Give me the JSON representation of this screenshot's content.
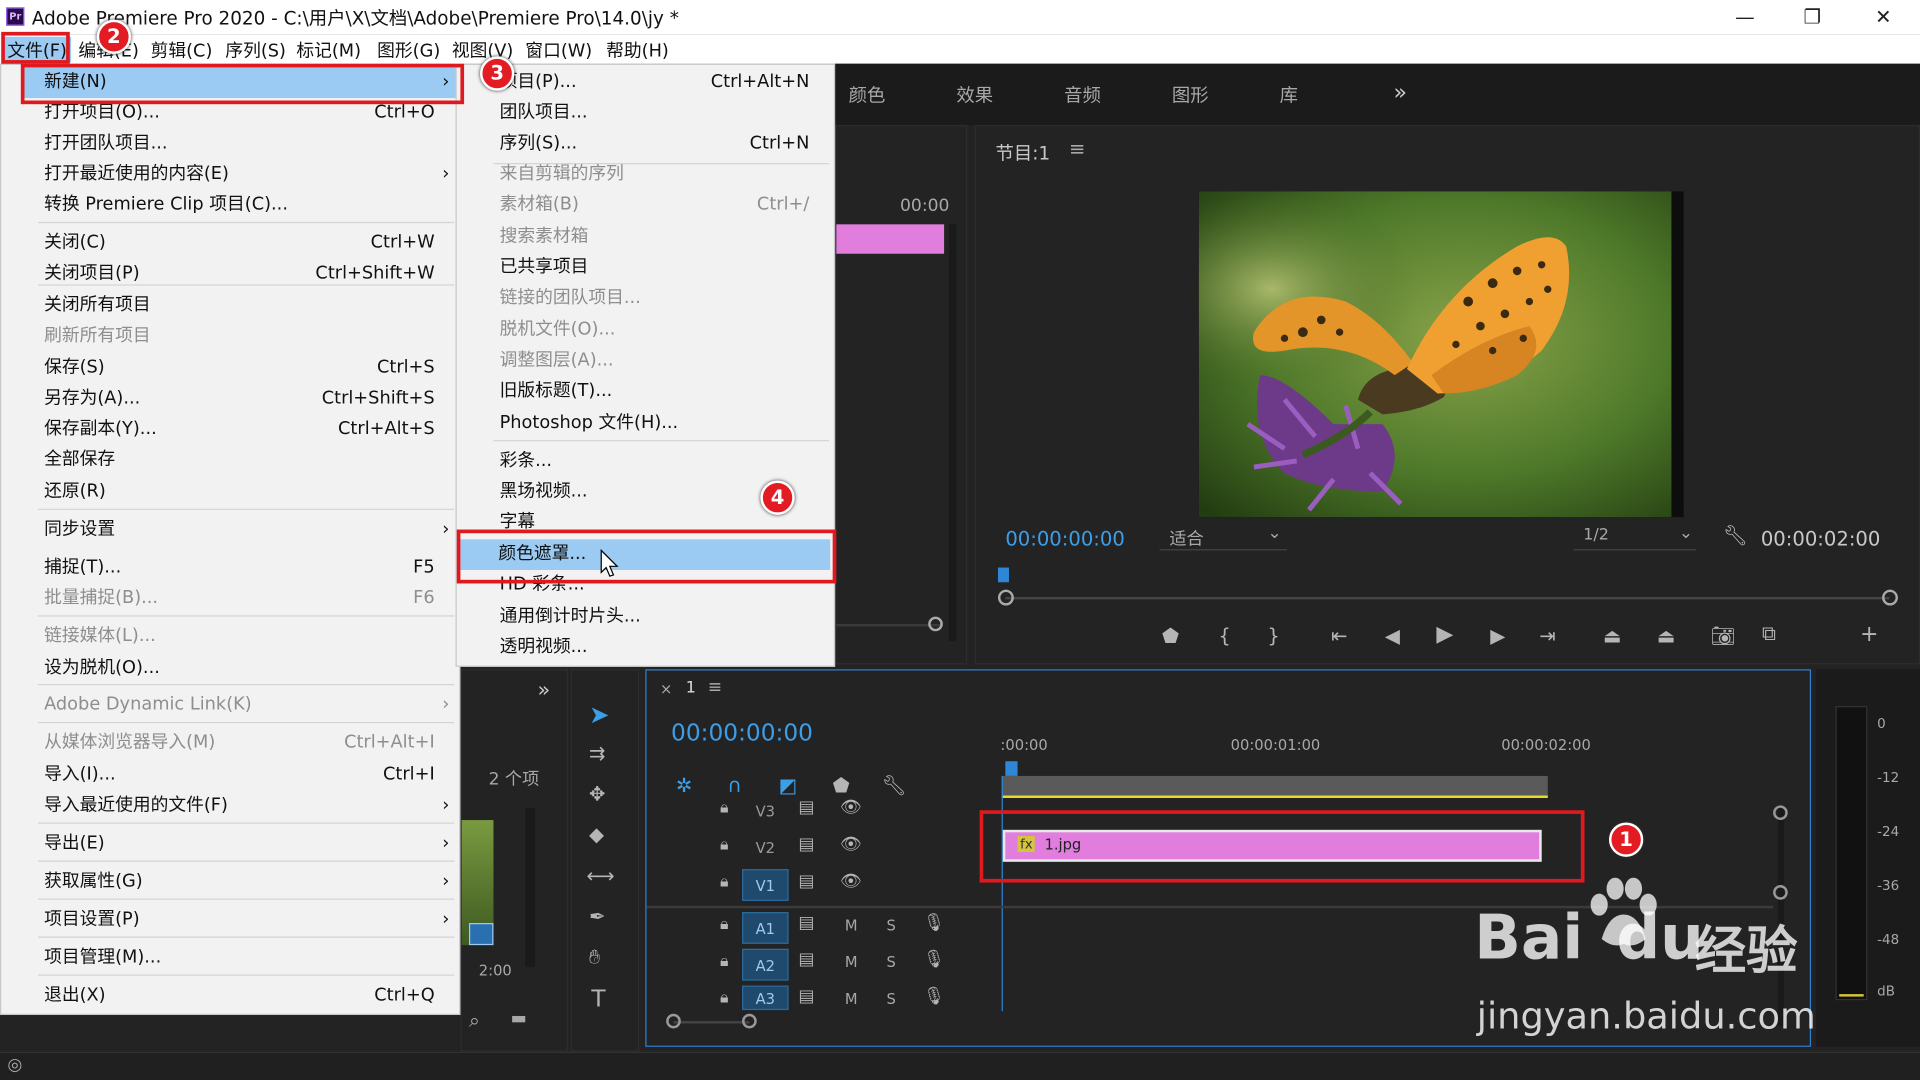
{
  "window": {
    "title": "Adobe Premiere Pro 2020 - C:\\用户\\X\\文档\\Adobe\\Premiere Pro\\14.0\\jy *",
    "app_icon": "Pr",
    "controls": {
      "minimize": "—",
      "maximize": "❐",
      "close": "✕"
    }
  },
  "menubar": [
    "文件(F)",
    "编辑(E)",
    "剪辑(C)",
    "序列(S)",
    "标记(M)",
    "图形(G)",
    "视图(V)",
    "窗口(W)",
    "帮助(H)"
  ],
  "file_menu": [
    {
      "label": "新建(N)",
      "arrow": "›"
    },
    {
      "label": "打开项目(O)...",
      "shortcut": "Ctrl+O"
    },
    {
      "label": "打开团队项目..."
    },
    {
      "label": "打开最近使用的内容(E)",
      "arrow": "›"
    },
    {
      "label": "转换 Premiere Clip 项目(C)..."
    },
    {
      "label": "关闭(C)",
      "shortcut": "Ctrl+W"
    },
    {
      "label": "关闭项目(P)",
      "shortcut": "Ctrl+Shift+W"
    },
    {
      "label": "关闭所有项目"
    },
    {
      "label": "刷新所有项目"
    },
    {
      "label": "保存(S)",
      "shortcut": "Ctrl+S"
    },
    {
      "label": "另存为(A)...",
      "shortcut": "Ctrl+Shift+S"
    },
    {
      "label": "保存副本(Y)...",
      "shortcut": "Ctrl+Alt+S"
    },
    {
      "label": "全部保存"
    },
    {
      "label": "还原(R)"
    },
    {
      "label": "同步设置",
      "arrow": "›"
    },
    {
      "label": "捕捉(T)...",
      "shortcut": "F5"
    },
    {
      "label": "批量捕捉(B)...",
      "shortcut": "F6"
    },
    {
      "label": "链接媒体(L)..."
    },
    {
      "label": "设为脱机(O)..."
    },
    {
      "label": "Adobe Dynamic Link(K)",
      "arrow": "›"
    },
    {
      "label": "从媒体浏览器导入(M)",
      "shortcut": "Ctrl+Alt+I"
    },
    {
      "label": "导入(I)...",
      "shortcut": "Ctrl+I"
    },
    {
      "label": "导入最近使用的文件(F)",
      "arrow": "›"
    },
    {
      "label": "导出(E)",
      "arrow": "›"
    },
    {
      "label": "获取属性(G)",
      "arrow": "›"
    },
    {
      "label": "项目设置(P)",
      "arrow": "›"
    },
    {
      "label": "项目管理(M)..."
    },
    {
      "label": "退出(X)",
      "shortcut": "Ctrl+Q"
    }
  ],
  "new_submenu": [
    {
      "label": "项目(P)...",
      "shortcut": "Ctrl+Alt+N"
    },
    {
      "label": "团队项目..."
    },
    {
      "label": "序列(S)...",
      "shortcut": "Ctrl+N"
    },
    {
      "label": "来自剪辑的序列"
    },
    {
      "label": "素材箱(B)",
      "shortcut": "Ctrl+/"
    },
    {
      "label": "搜索素材箱"
    },
    {
      "label": "已共享项目"
    },
    {
      "label": "链接的团队项目..."
    },
    {
      "label": "脱机文件(O)..."
    },
    {
      "label": "调整图层(A)..."
    },
    {
      "label": "旧版标题(T)..."
    },
    {
      "label": "Photoshop 文件(H)..."
    },
    {
      "label": "彩条..."
    },
    {
      "label": "黑场视频..."
    },
    {
      "label": "字幕"
    },
    {
      "label": "颜色遮罩..."
    },
    {
      "label": "HD 彩条..."
    },
    {
      "label": "通用倒计时片头..."
    },
    {
      "label": "透明视频..."
    }
  ],
  "badges": [
    "1",
    "2",
    "3",
    "4"
  ],
  "workspace_tabs": [
    "颜色",
    "效果",
    "音频",
    "图形",
    "库"
  ],
  "program_monitor": {
    "title": "节目:1",
    "timecode": "00:00:00:00",
    "fit": "适合",
    "resolution": "1/2",
    "duration": "00:00:02:00"
  },
  "source_panel": {
    "timecode": "00:00"
  },
  "project_panel": {
    "count": "2 个项",
    "clip_duration": "2:00"
  },
  "timeline": {
    "sequence_name": "1",
    "timecode": "00:00:00:00",
    "ruler": [
      ":00:00",
      "00:00:01:00",
      "00:00:02:00"
    ],
    "clip_label": "1.jpg",
    "fx_label": "fx",
    "video_tracks": [
      "V3",
      "V2",
      "V1"
    ],
    "audio_tracks": [
      "A1",
      "A2",
      "A3"
    ],
    "audio_buttons": {
      "mute": "M",
      "solo": "S"
    }
  },
  "audio_meter": {
    "scale": [
      "0",
      "-12",
      "-24",
      "-36",
      "-48",
      "dB"
    ]
  },
  "watermark": {
    "brand": "Bai",
    "brand2": "du",
    "brand3": "经验",
    "url": "jingyan.baidu.com"
  }
}
